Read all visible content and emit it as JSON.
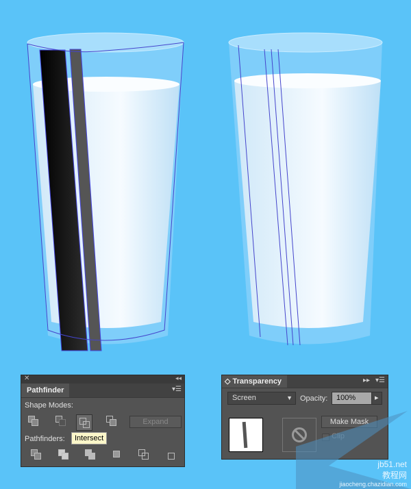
{
  "colors": {
    "background": "#5ac3f8",
    "panel": "#535353",
    "tooltip": "#fbf6c9",
    "anchor": "#3a3acc"
  },
  "pathfinder": {
    "tab": "Pathfinder",
    "shape_modes_label": "Shape Modes:",
    "shape_modes": [
      "unite",
      "minus-front",
      "intersect",
      "exclude"
    ],
    "expand_label": "Expand",
    "pathfinders_label": "Pathfinders:",
    "pathfinders": [
      "divide",
      "trim",
      "merge",
      "crop",
      "outline",
      "minus-back"
    ],
    "tooltip": "Intersect"
  },
  "transparency": {
    "tab": "Transparency",
    "blend_mode": "Screen",
    "opacity_label": "Opacity:",
    "opacity": "100%",
    "make_mask_label": "Make Mask",
    "clip_label": "Clip"
  },
  "watermark": {
    "line1": "jb51.net",
    "line2": "教程网",
    "line3": "jiaocheng.chazidian.com"
  }
}
